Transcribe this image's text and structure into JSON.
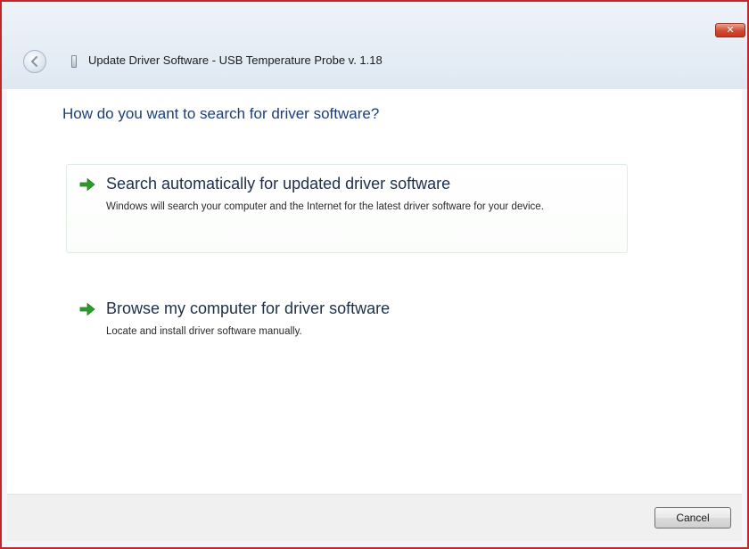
{
  "window": {
    "title": "Update Driver Software - USB Temperature Probe v. 1.18",
    "close_glyph": "✕"
  },
  "main": {
    "heading": "How do you want to search for driver software?",
    "options": [
      {
        "title": "Search automatically for updated driver software",
        "description": "Windows will search your computer and the Internet for the latest driver software for your device.",
        "icon": "green-arrow-icon"
      },
      {
        "title": "Browse my computer for driver software",
        "description": "Locate and install driver software manually.",
        "icon": "green-arrow-icon"
      }
    ]
  },
  "footer": {
    "cancel_label": "Cancel"
  },
  "colors": {
    "heading": "#1c3f78",
    "arrow": "#2e9a2e",
    "close_button": "#cf4a31",
    "window_border": "#c0282c"
  }
}
